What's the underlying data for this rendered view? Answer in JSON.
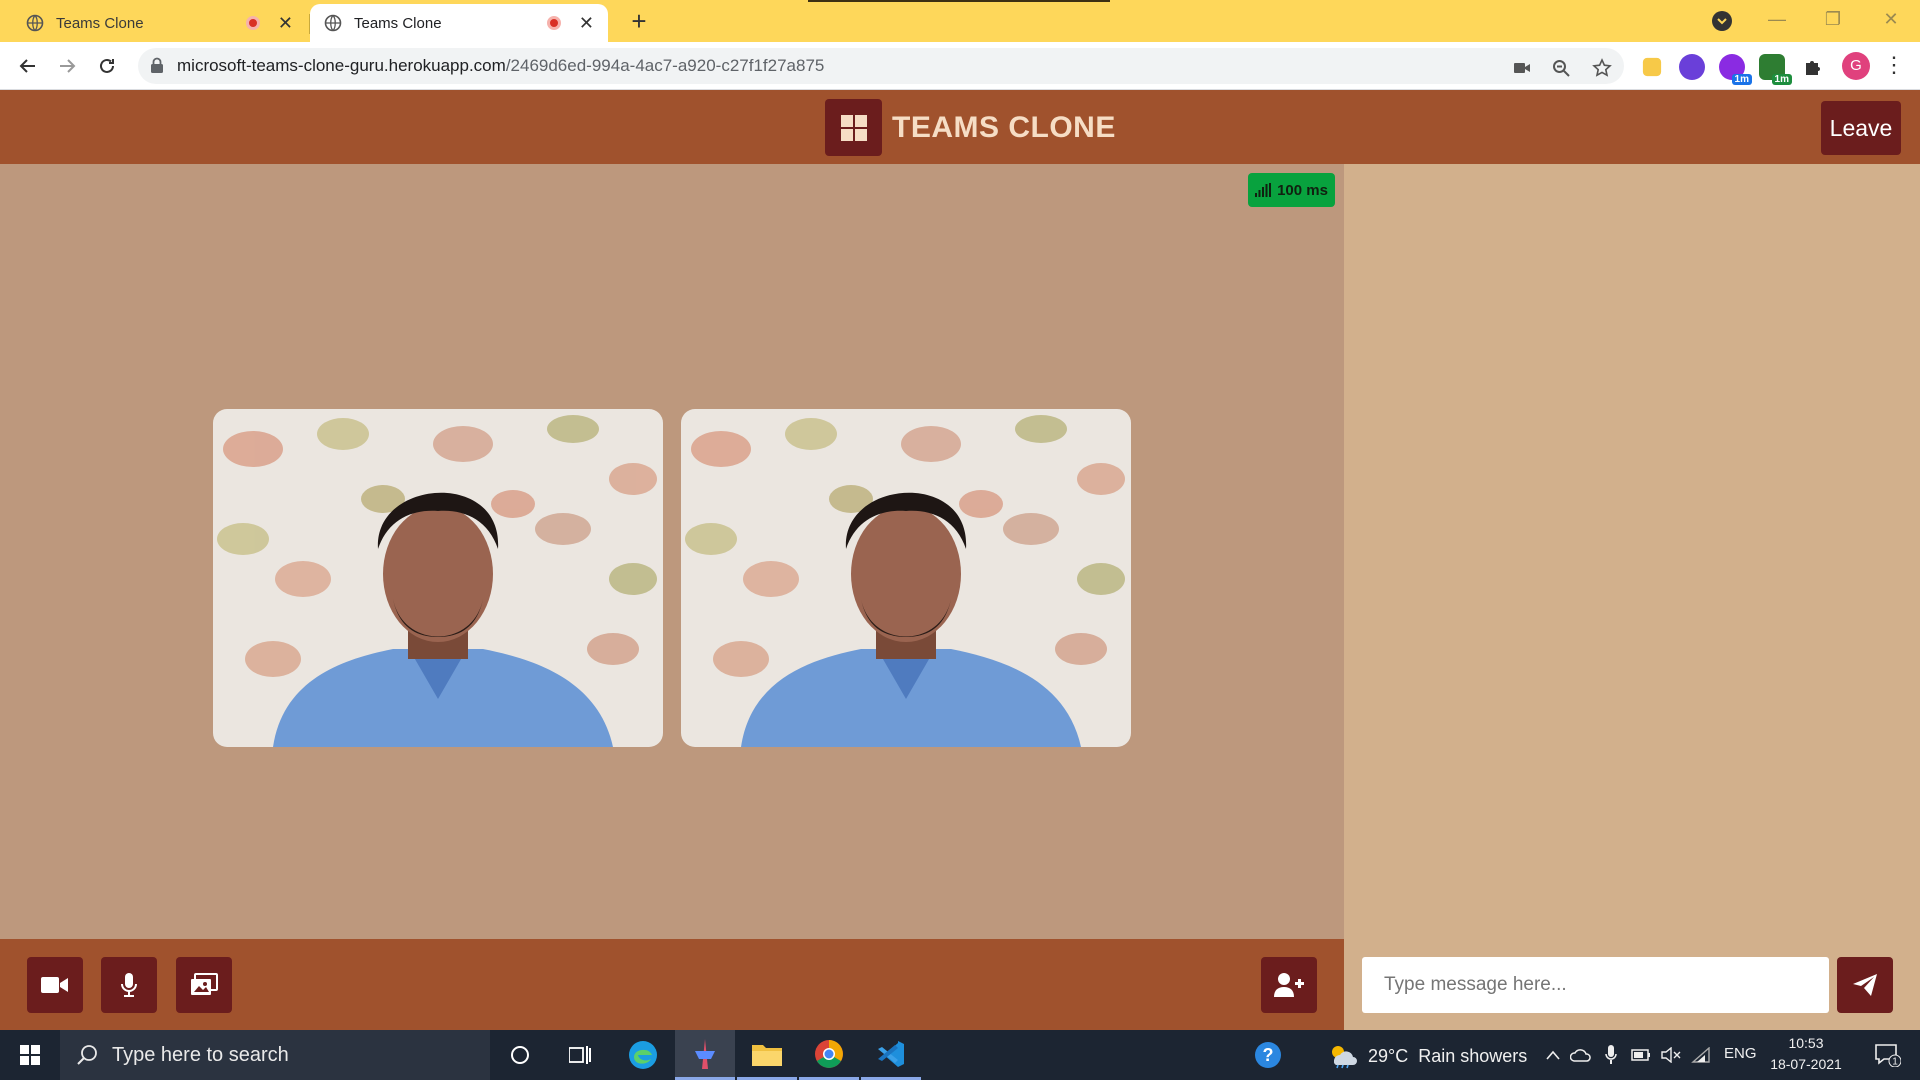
{
  "browser": {
    "tabs": [
      {
        "title": "Teams Clone",
        "active": false
      },
      {
        "title": "Teams Clone",
        "active": true
      }
    ],
    "url_host": "microsoft-teams-clone-guru.herokuapp.com",
    "url_path": "/2469d6ed-994a-4ac7-a920-c27f1f27a875",
    "extension_badges": [
      "1m",
      "1m"
    ],
    "profile_initial": "G"
  },
  "app": {
    "title": "TEAMS CLONE",
    "leave_label": "Leave",
    "latency": "100 ms",
    "chat": {
      "placeholder": "Type message here..."
    },
    "controls": [
      "video-camera-icon",
      "microphone-icon",
      "screen-share-icon",
      "add-user-icon"
    ],
    "colors": {
      "header": "#a0522d",
      "button": "#6b1d1d",
      "video_area": "#bd987d",
      "chat_panel": "#d2b08c",
      "latency_badge": "#08a23e"
    }
  },
  "taskbar": {
    "search_placeholder": "Type here to search",
    "weather": "29°C  Rain showers",
    "language": "ENG",
    "time": "10:53",
    "date": "18-07-2021",
    "notification_count": "1"
  }
}
